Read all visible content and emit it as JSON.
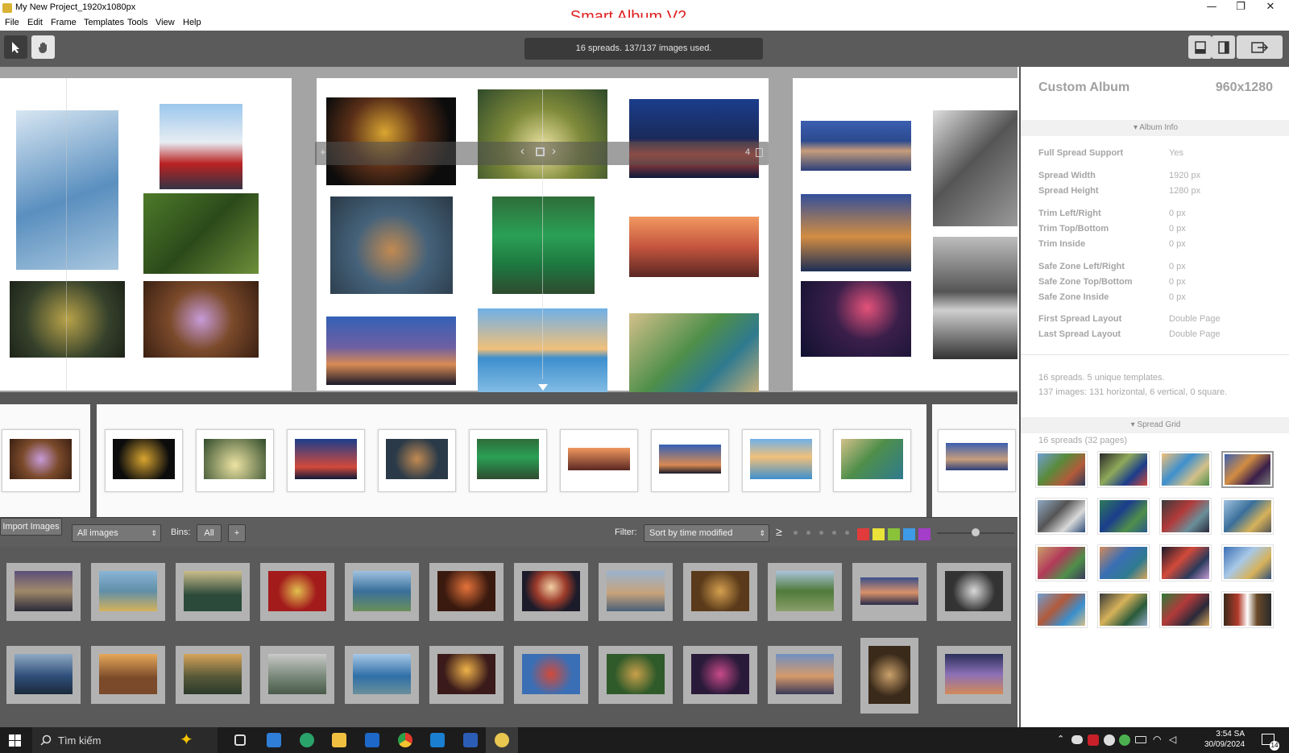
{
  "window": {
    "title": "My New Project_1920x1080px",
    "brand": "Smart Album V2",
    "minimize": "—",
    "maximize": "❐",
    "close": "✕"
  },
  "menu": [
    "File",
    "Edit",
    "Frame",
    "Templates",
    "Tools",
    "View",
    "Help"
  ],
  "toolbar": {
    "status": "16 spreads. 137/137 images used.",
    "select_icon": "cursor-arrow-icon",
    "pan_icon": "hand-icon"
  },
  "spread": {
    "page_number": "4"
  },
  "imagebar": {
    "import_label": "Import Images",
    "source_value": "All images",
    "bins_label": "Bins:",
    "bins_value": "All",
    "add_bin": "+",
    "filter_label": "Filter:",
    "sort_value": "Sort by time modified",
    "rating_op": "≥",
    "colors": [
      "#e23b3b",
      "#e9e33a",
      "#8ac23a",
      "#3d9be8",
      "#a43dc8"
    ]
  },
  "panel": {
    "title": "Custom Album",
    "size": "960x1280",
    "album_info_header": "Album Info",
    "rows": [
      {
        "k": "Full Spread Support",
        "v": "Yes"
      },
      {
        "k": "Spread Width",
        "v": "1920 px"
      },
      {
        "k": "Spread Height",
        "v": "1280 px"
      },
      {
        "k": "Trim Left/Right",
        "v": "0 px"
      },
      {
        "k": "Trim Top/Bottom",
        "v": "0 px"
      },
      {
        "k": "Trim Inside",
        "v": "0 px"
      },
      {
        "k": "Safe Zone Left/Right",
        "v": "0 px"
      },
      {
        "k": "Safe Zone Top/Bottom",
        "v": "0 px"
      },
      {
        "k": "Safe Zone Inside",
        "v": "0 px"
      },
      {
        "k": "First Spread Layout",
        "v": "Double Page"
      },
      {
        "k": "Last Spread Layout",
        "v": "Double Page"
      }
    ],
    "summary1": "16 spreads. 5 unique templates.",
    "summary2": "137 images: 131 horizontal, 6 vertical, 0 square.",
    "spread_grid_header": "Spread Grid",
    "spread_grid_sub": "16 spreads (32 pages)"
  },
  "taskbar": {
    "search": "Tìm kiếm",
    "time": "3:54 SA",
    "date": "30/09/2024",
    "notif": "14"
  }
}
